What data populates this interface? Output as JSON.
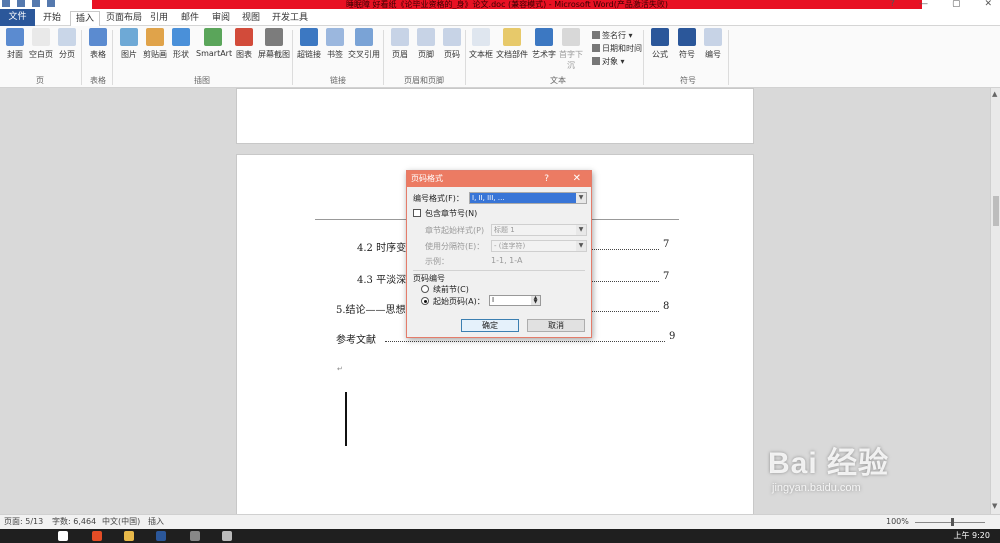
{
  "title_bar": {
    "title": "睡眠障 好看纸《论毕业资格的_身》论文.doc (兼容模式) - Microsoft Word(产品激活失败)",
    "win_controls": [
      "?",
      "—",
      "▢",
      "✕"
    ]
  },
  "tabs": [
    {
      "label": "文件",
      "kind": "file"
    },
    {
      "label": "开始",
      "kind": "normal"
    },
    {
      "label": "插入",
      "kind": "active"
    },
    {
      "label": "页面布局",
      "kind": "normal"
    },
    {
      "label": "引用",
      "kind": "normal"
    },
    {
      "label": "邮件",
      "kind": "normal"
    },
    {
      "label": "审阅",
      "kind": "normal"
    },
    {
      "label": "视图",
      "kind": "normal"
    },
    {
      "label": "开发工具",
      "kind": "normal"
    }
  ],
  "ribbon": {
    "buttons": [
      {
        "label": "封面",
        "icon": "cover-page-icon",
        "color": "#5b8bd0"
      },
      {
        "label": "空白页",
        "icon": "blank-page-icon",
        "color": "#e9e9e9"
      },
      {
        "label": "分页",
        "icon": "page-break-icon",
        "color": "#c9d6e8"
      },
      {
        "label": "表格",
        "icon": "table-icon",
        "color": "#5b8bd0"
      },
      {
        "label": "图片",
        "icon": "picture-icon",
        "color": "#6ea9d6"
      },
      {
        "label": "剪贴画",
        "icon": "clip-art-icon",
        "color": "#e0a34a"
      },
      {
        "label": "形状",
        "icon": "shapes-icon",
        "color": "#4a90d9"
      },
      {
        "label": "SmartArt",
        "icon": "smartart-icon",
        "color": "#5aa55a"
      },
      {
        "label": "图表",
        "icon": "chart-icon",
        "color": "#d24b3a"
      },
      {
        "label": "屏幕截图",
        "icon": "screenshot-icon",
        "color": "#7c7c7c"
      },
      {
        "label": "超链接",
        "icon": "hyperlink-icon",
        "color": "#3c78c2"
      },
      {
        "label": "书签",
        "icon": "bookmark-icon",
        "color": "#9bb7de"
      },
      {
        "label": "交叉引用",
        "icon": "cross-reference-icon",
        "color": "#7aa3d6"
      },
      {
        "label": "页眉",
        "icon": "header-icon",
        "color": "#c7d3e6"
      },
      {
        "label": "页脚",
        "icon": "footer-icon",
        "color": "#c7d3e6"
      },
      {
        "label": "页码",
        "icon": "page-number-icon",
        "color": "#c7d3e6"
      },
      {
        "label": "文本框",
        "icon": "text-box-icon",
        "color": "#dfe6ef"
      },
      {
        "label": "文档部件",
        "icon": "quick-parts-icon",
        "color": "#e7c96a"
      },
      {
        "label": "艺术字",
        "icon": "wordart-icon",
        "color": "#3c78c2"
      },
      {
        "label": "首字下沉",
        "icon": "drop-cap-icon",
        "color": "#d8d8d8"
      },
      {
        "label": "公式",
        "icon": "equation-icon",
        "color": "#2b579a"
      },
      {
        "label": "符号",
        "icon": "symbol-icon",
        "color": "#2b579a"
      },
      {
        "label": "编号",
        "icon": "number-icon",
        "color": "#c7d3e6"
      }
    ],
    "small_buttons": [
      {
        "label": "签名行 ▾"
      },
      {
        "label": "日期和时间"
      },
      {
        "label": "对象 ▾"
      }
    ],
    "groups": [
      "页",
      "表格",
      "插图",
      "链接",
      "页眉和页脚",
      "文本",
      "符号"
    ]
  },
  "document": {
    "toc": [
      {
        "text": "4.2 时序变化",
        "page": "7"
      },
      {
        "text": "4.3 平淡深情",
        "page": "7"
      },
      {
        "text": "5.结论——思想",
        "page": "8"
      },
      {
        "text": "参考文献",
        "page": "9"
      }
    ]
  },
  "dialog": {
    "title": "页码格式",
    "help": "?",
    "close": "✕",
    "number_format_label": "编号格式(F)：",
    "number_format_value": "I, II, III, …",
    "include_chapter_label": "包含章节号(N)",
    "chapter_style_label": "章节起始样式(P)",
    "chapter_style_value": "标题 1",
    "separator_label": "使用分隔符(E)：",
    "separator_value": "-  (连字符)",
    "example_label": "示例：",
    "example_value": "1-1, 1-A",
    "numbering_section": "页码编号",
    "continue_label": "续前节(C)",
    "start_at_label": "起始页码(A)：",
    "start_at_value": "I",
    "ok": "确定",
    "cancel": "取消"
  },
  "status_bar": {
    "page": "页面: 5/13",
    "words": "字数: 6,464",
    "language": "中文(中国)",
    "mode": "插入",
    "zoom": "100%"
  },
  "taskbar": {
    "time": "上午 9:20"
  },
  "watermark": {
    "brand": "Bai 经验",
    "url": "jingyan.baidu.com"
  }
}
